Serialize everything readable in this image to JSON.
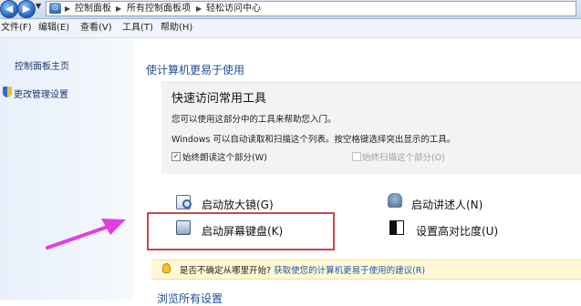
{
  "addressbar": {
    "crumbs": [
      "控制面板",
      "所有控制面板项",
      "轻松访问中心"
    ]
  },
  "menubar": {
    "items": [
      "文件(F)",
      "编辑(E)",
      "查看(V)",
      "工具(T)",
      "帮助(H)"
    ]
  },
  "sidebar": {
    "home": "控制面板主页",
    "admin": "更改管理设置"
  },
  "main": {
    "heading": "使计算机更易于使用",
    "quick": {
      "title": "快速访问常用工具",
      "desc1": "您可以使用这部分中的工具来帮助您入门。",
      "desc2": "Windows 可以自动读取和扫描这个列表。按空格键选择突出显示的工具。",
      "cb_read": {
        "label": "始终朗读这个部分(W)",
        "checked": true
      },
      "cb_scan": {
        "label": "始终扫描这个部分(O)",
        "checked": false
      }
    },
    "tools": {
      "magnifier": "启动放大镜(G)",
      "narrator": "启动讲述人(N)",
      "keyboard": "启动屏幕键盘(K)",
      "contrast": "设置高对比度(U)"
    },
    "hint": {
      "question": "是否不确定从哪里开始?",
      "link": "获取使您的计算机更易于使用的建议(R)"
    },
    "browse": "浏览所有设置"
  },
  "colors": {
    "highlight_box": "#c7484c",
    "arrow": "#e23fe0",
    "link": "#1e5aa8"
  }
}
